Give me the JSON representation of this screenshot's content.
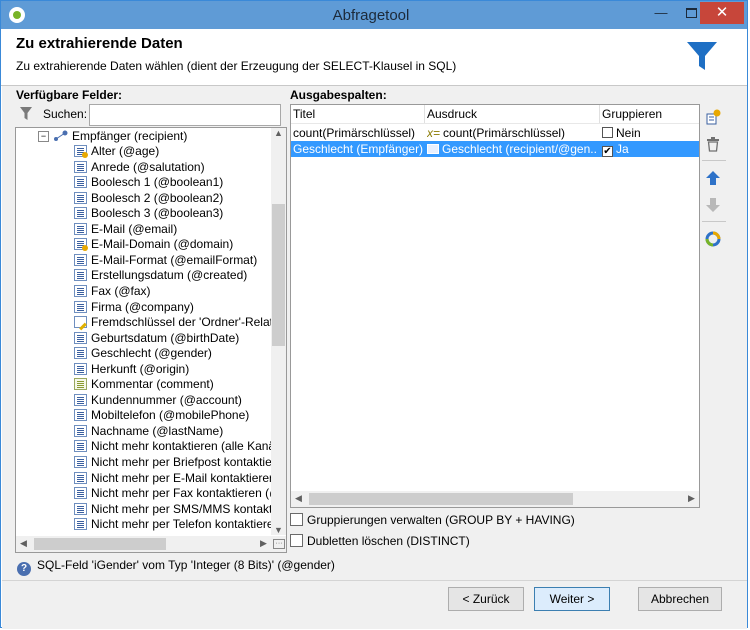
{
  "window": {
    "title": "Abfragetool",
    "min_label": "—",
    "close_label": "✕"
  },
  "header": {
    "title": "Zu extrahierende Daten",
    "subtitle": "Zu extrahierende Daten wählen (dient der Erzeugung der SELECT-Klausel in SQL)",
    "icon": "funnel-icon"
  },
  "left": {
    "label": "Verfügbare Felder:",
    "search_label": "Suchen:",
    "search_value": "",
    "tree": {
      "root": {
        "label": "Empfänger (recipient)",
        "expander": "−"
      },
      "items": [
        {
          "label": "Alter (@age)",
          "icon": "calculated-field-icon"
        },
        {
          "label": "Anrede (@salutation)",
          "icon": "field-icon"
        },
        {
          "label": "Boolesch 1 (@boolean1)",
          "icon": "field-icon"
        },
        {
          "label": "Boolesch 2 (@boolean2)",
          "icon": "field-icon"
        },
        {
          "label": "Boolesch 3 (@boolean3)",
          "icon": "field-icon"
        },
        {
          "label": "E-Mail (@email)",
          "icon": "field-icon"
        },
        {
          "label": "E-Mail-Domain (@domain)",
          "icon": "calculated-field-icon"
        },
        {
          "label": "E-Mail-Format (@emailFormat)",
          "icon": "field-icon"
        },
        {
          "label": "Erstellungsdatum (@created)",
          "icon": "field-icon"
        },
        {
          "label": "Fax (@fax)",
          "icon": "field-icon"
        },
        {
          "label": "Firma (@company)",
          "icon": "field-icon"
        },
        {
          "label": "Fremdschlüssel der 'Ordner'-Relatio",
          "icon": "link-field-icon"
        },
        {
          "label": "Geburtsdatum (@birthDate)",
          "icon": "field-icon"
        },
        {
          "label": "Geschlecht (@gender)",
          "icon": "field-icon"
        },
        {
          "label": "Herkunft (@origin)",
          "icon": "field-icon"
        },
        {
          "label": "Kommentar (comment)",
          "icon": "comment-field-icon"
        },
        {
          "label": "Kundennummer (@account)",
          "icon": "field-icon"
        },
        {
          "label": "Mobiltelefon (@mobilePhone)",
          "icon": "field-icon"
        },
        {
          "label": "Nachname (@lastName)",
          "icon": "field-icon"
        },
        {
          "label": "Nicht mehr kontaktieren (alle Kanä",
          "icon": "field-icon"
        },
        {
          "label": "Nicht mehr per Briefpost kontaktier",
          "icon": "field-icon"
        },
        {
          "label": "Nicht mehr per E-Mail kontaktierer",
          "icon": "field-icon"
        },
        {
          "label": "Nicht mehr per Fax kontaktieren (@",
          "icon": "field-icon"
        },
        {
          "label": "Nicht mehr per SMS/MMS kontakti",
          "icon": "field-icon"
        },
        {
          "label": "Nicht mehr per Telefon kontaktiere",
          "icon": "field-icon"
        }
      ]
    }
  },
  "right": {
    "label": "Ausgabespalten:",
    "columns": [
      "Titel",
      "Ausdruck",
      "Gruppieren"
    ],
    "rows": [
      {
        "title": "count(Primärschlüssel)",
        "expression": "count(Primärschlüssel)",
        "expression_icon": "formula-icon",
        "group_checked": false,
        "group_label": "Nein",
        "selected": false
      },
      {
        "title": "Geschlecht (Empfänger)",
        "expression": "Geschlecht (recipient/@gen...",
        "expression_icon": "field-icon",
        "group_checked": true,
        "group_label": "Ja",
        "selected": true
      }
    ],
    "options": [
      {
        "label": "Gruppierungen verwalten (GROUP BY + HAVING)",
        "checked": false
      },
      {
        "label": "Dubletten löschen (DISTINCT)",
        "checked": false
      }
    ],
    "tools": [
      "add-icon",
      "delete-icon",
      "move-up-icon",
      "move-down-icon",
      "distribution-icon"
    ]
  },
  "status": {
    "text": "SQL-Feld 'iGender' vom Typ 'Integer (8 Bits)' (@gender)",
    "icon": "help-icon"
  },
  "buttons": {
    "back": "< Zurück",
    "next": "Weiter >",
    "cancel": "Abbrechen"
  },
  "accent_colors": {
    "selection": "#3399ff",
    "titlebar": "#5f9bd6",
    "close": "#c7463a"
  }
}
